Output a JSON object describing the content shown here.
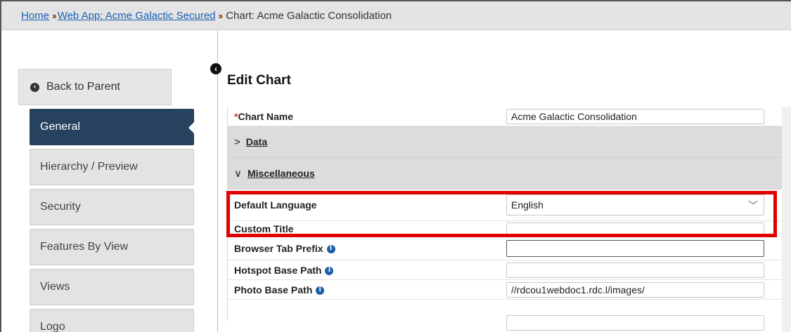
{
  "breadcrumb": {
    "home": "Home",
    "web_app": "Web App: Acme Galactic Secured",
    "current": "Chart: Acme Galactic Consolidation",
    "separator": "››"
  },
  "sidebar": {
    "back_label": "Back to Parent",
    "items": [
      {
        "label": "General",
        "active": true
      },
      {
        "label": "Hierarchy / Preview",
        "active": false
      },
      {
        "label": "Security",
        "active": false
      },
      {
        "label": "Features By View",
        "active": false
      },
      {
        "label": "Views",
        "active": false
      },
      {
        "label": "Logo",
        "active": false
      }
    ]
  },
  "page": {
    "title": "Edit Chart"
  },
  "form": {
    "chart_name": {
      "label": "Chart Name",
      "required_mark": "*",
      "value": "Acme Galactic Consolidation"
    },
    "data_section": {
      "label": "Data",
      "chevron": ">"
    },
    "misc_section": {
      "label": "Miscellaneous",
      "chevron": "∨"
    },
    "default_language": {
      "label": "Default Language",
      "value": "English"
    },
    "custom_title": {
      "label": "Custom Title",
      "value": ""
    },
    "browser_tab_prefix": {
      "label": "Browser Tab Prefix",
      "value": ""
    },
    "hotspot_base_path": {
      "label": "Hotspot Base Path",
      "value": ""
    },
    "photo_base_path": {
      "label": "Photo Base Path",
      "value": "//rdcou1webdoc1.rdc.l/images/"
    }
  },
  "colors": {
    "active_nav": "#27425e",
    "highlight": "#e00000",
    "link": "#1a5fb4"
  }
}
